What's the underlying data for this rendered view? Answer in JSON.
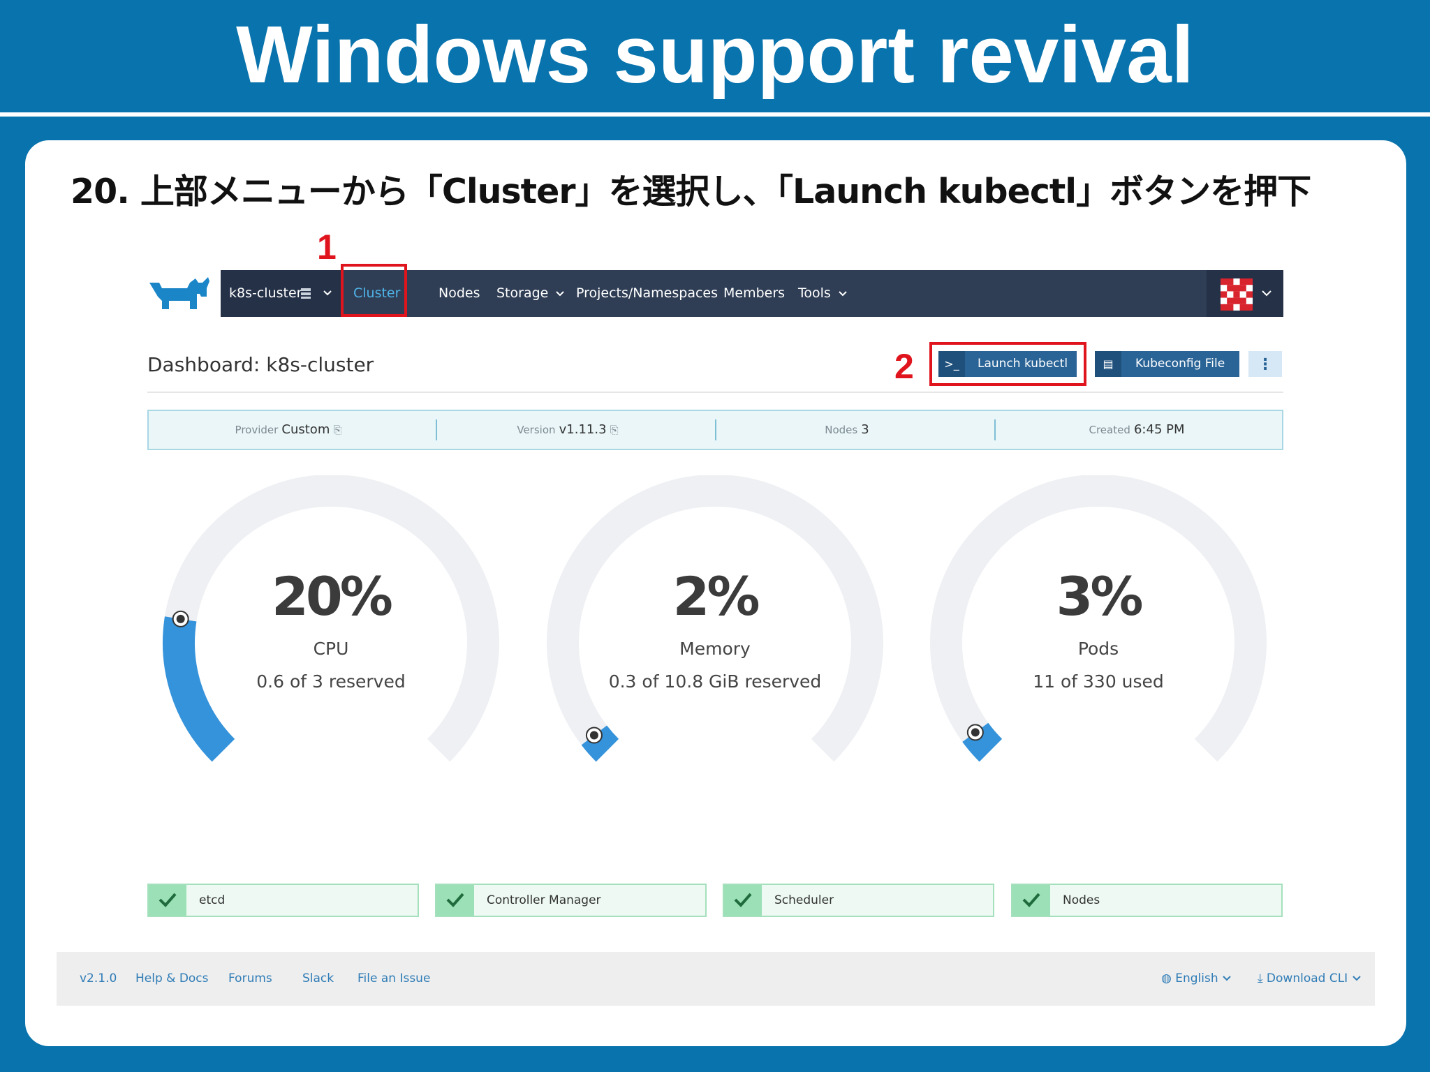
{
  "slide": {
    "title": "Windows support revival",
    "step": "20. 上部メニューから「Cluster」を選択し、「Launch kubectl」ボタンを押下"
  },
  "annotations": {
    "marker1": "1",
    "marker2": "2"
  },
  "nav": {
    "cluster_selector": "k8s-cluster",
    "items": [
      "Cluster",
      "Nodes",
      "Storage",
      "Projects/Namespaces",
      "Members",
      "Tools"
    ],
    "active": "Cluster"
  },
  "dashboard": {
    "title": "Dashboard: k8s-cluster",
    "launch_kubectl": "Launch kubectl",
    "kubeconfig_file": "Kubeconfig File",
    "more": "⋮"
  },
  "info": {
    "provider_label": "Provider",
    "provider_value": "Custom",
    "version_label": "Version",
    "version_value": "v1.11.3",
    "nodes_label": "Nodes",
    "nodes_value": "3",
    "created_label": "Created",
    "created_value": "6:45 PM"
  },
  "gauges": [
    {
      "percent": "20%",
      "label": "CPU",
      "detail": "0.6 of 3 reserved",
      "fraction": 0.2
    },
    {
      "percent": "2%",
      "label": "Memory",
      "detail": "0.3 of 10.8 GiB reserved",
      "fraction": 0.028
    },
    {
      "percent": "3%",
      "label": "Pods",
      "detail": "11 of 330 used",
      "fraction": 0.033
    }
  ],
  "components": [
    "etcd",
    "Controller Manager",
    "Scheduler",
    "Nodes"
  ],
  "footer": {
    "version": "v2.1.0",
    "links": [
      "Help & Docs",
      "Forums",
      "Slack",
      "File an Issue"
    ],
    "language": "English",
    "download": "Download CLI"
  },
  "colors": {
    "slide_bg": "#0873ac",
    "navbar": "#2f3e55",
    "accent_blue": "#3593db",
    "annotation_red": "#e0141d",
    "status_green": "#9be0b6"
  }
}
